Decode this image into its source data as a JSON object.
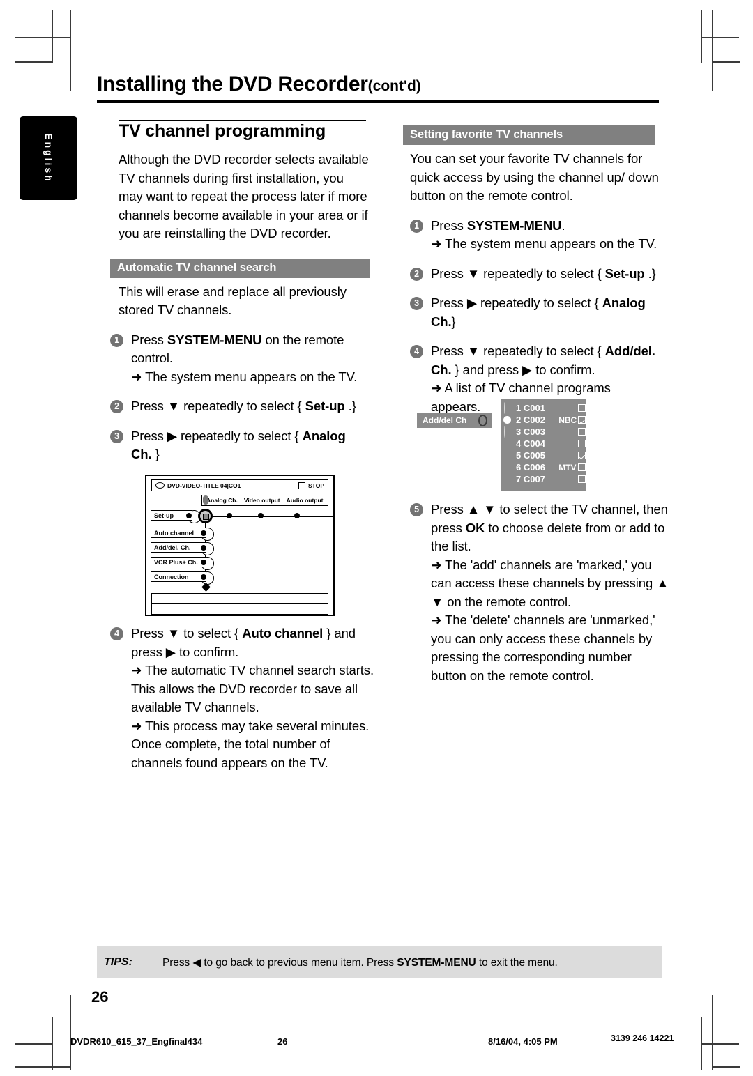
{
  "language_tab": "English",
  "header": {
    "title": "Installing the DVD Recorder",
    "contd": "(cont'd)"
  },
  "left_column": {
    "section_title": "TV channel programming",
    "intro": "Although the DVD recorder selects available TV channels during first installation, you may want to repeat the process later if more channels become available in your area or if you are reinstalling the DVD recorder.",
    "band_title": "Automatic  TV channel search",
    "band_intro": "This will erase and replace all previously stored TV channels.",
    "steps": [
      {
        "num": "1",
        "text_pre": "Press ",
        "bold": "SYSTEM-MENU",
        "text_post": " on the remote control.",
        "result": "➜ The system menu appears on the TV."
      },
      {
        "num": "2",
        "text_pre": "Press ▼ repeatedly to select { ",
        "bold": "Set-up",
        "text_post": " .}",
        "result": ""
      },
      {
        "num": "3",
        "text_pre": "Press ▶ repeatedly to select { ",
        "bold": "Analog Ch.",
        "text_post": " }",
        "result": ""
      },
      {
        "num": "4",
        "text_pre": "Press ▼ to select { ",
        "bold": "Auto channel",
        "text_post": " } and press ▶ to confirm.",
        "result": "➜ The automatic TV channel search starts. This allows the DVD recorder to save all available TV channels.",
        "result2": "➜ This process may take several minutes. Once complete, the total number of channels found appears on the TV."
      }
    ]
  },
  "tv_menu": {
    "title_bar_left": "DVD-VIDEO-TITLE 04|CO1",
    "title_bar_right": "STOP",
    "tabs": [
      "Analog Ch.",
      "Video output",
      "Audio output"
    ],
    "selected_tab": "Set-up",
    "menu_items": [
      "Auto channel",
      "Add/del. Ch.",
      "VCR Plus+ Ch.",
      "Connection"
    ]
  },
  "right_column": {
    "band_title": "Setting favorite TV channels",
    "intro": "You can set your favorite TV channels for quick access by using the channel up/ down button on the remote control.",
    "steps": [
      {
        "num": "1",
        "text_pre": "Press ",
        "bold": "SYSTEM-MENU",
        "text_post": ".",
        "result": "➜ The system menu appears on the TV."
      },
      {
        "num": "2",
        "text_pre": "Press ▼ repeatedly to select { ",
        "bold": "Set-up",
        "text_post": " .}",
        "result": ""
      },
      {
        "num": "3",
        "text_pre": "Press ▶ repeatedly to select { ",
        "bold": "Analog Ch.",
        "text_post": "}",
        "result": ""
      },
      {
        "num": "4",
        "text_pre": "Press ▼ repeatedly to select { ",
        "bold": "Add/del. Ch.",
        "text_post": " } and press ▶ to confirm.",
        "result": "➜ A list of TV channel programs appears."
      },
      {
        "num": "5",
        "text_pre": "Press ▲ ▼ to select the TV channel, then press ",
        "bold": "OK",
        "text_post": " to choose delete from or add to the list.",
        "result": "➜  The 'add' channels are 'marked,' you can access these channels by pressing ▲ ▼ on the remote control.",
        "result2": "➜ The 'delete' channels are 'unmarked,' you can only access these channels by pressing the corresponding number button on the remote control."
      }
    ]
  },
  "channel_screen": {
    "label": "Add/del Ch",
    "rows": [
      {
        "index": "1",
        "code": "C001",
        "name": "",
        "checked": false,
        "cursor": false
      },
      {
        "index": "2",
        "code": "C002",
        "name": "NBC",
        "checked": true,
        "cursor": true
      },
      {
        "index": "3",
        "code": "C003",
        "name": "",
        "checked": false,
        "cursor": false
      },
      {
        "index": "4",
        "code": "C004",
        "name": "",
        "checked": false,
        "cursor": false
      },
      {
        "index": "5",
        "code": "C005",
        "name": "",
        "checked": true,
        "cursor": false
      },
      {
        "index": "6",
        "code": "C006",
        "name": "MTV",
        "checked": false,
        "cursor": false
      },
      {
        "index": "7",
        "code": "C007",
        "name": "",
        "checked": false,
        "cursor": false
      }
    ]
  },
  "tips": {
    "label": "TIPS:",
    "text_pre": "Press ◀ to go back to previous menu item.  Press ",
    "bold": "SYSTEM-MENU",
    "text_post": " to exit the menu."
  },
  "page_number": "26",
  "footer": {
    "file": "DVDR610_615_37_Engfinal434",
    "page": "26",
    "timestamp": "8/16/04, 4:05 PM",
    "code": "3139 246 14221"
  },
  "colors": {
    "band_gray": "#808080",
    "tips_gray": "#dcdcdc",
    "screen_gray": "#8a8a8a",
    "bullet_gray": "#737373"
  }
}
